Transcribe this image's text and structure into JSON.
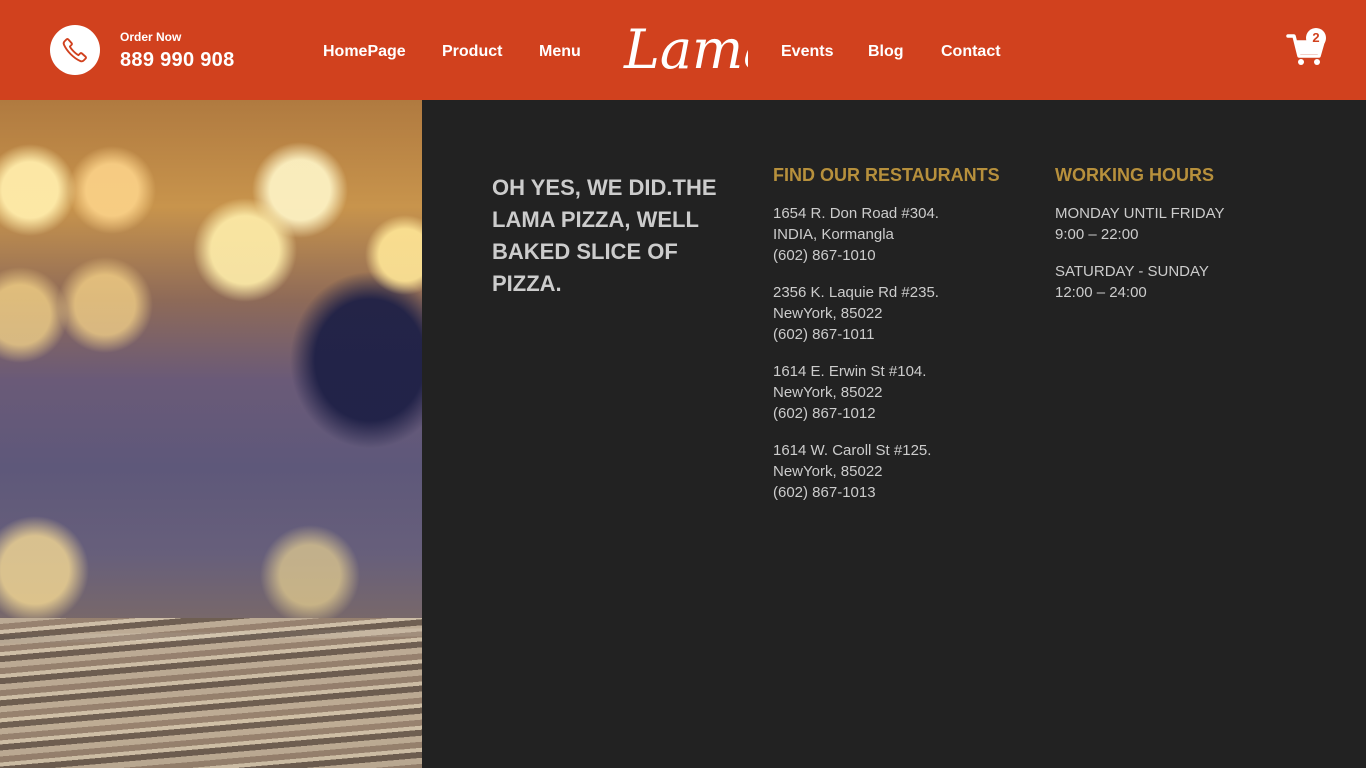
{
  "header": {
    "order_label": "Order Now",
    "order_number": "889 990 908",
    "nav": {
      "homepage": "HomePage",
      "product": "Product",
      "menu": "Menu",
      "events": "Events",
      "blog": "Blog",
      "contact": "Contact"
    },
    "logo_text": "Lama",
    "cart_count": "2",
    "icons": {
      "phone": "phone-icon",
      "cart": "cart-icon"
    }
  },
  "footer": {
    "motto": "OH YES, WE DID.THE LAMA PIZZA, WELL BAKED SLICE OF PIZZA.",
    "restaurants_title": "FIND OUR RESTAURANTS",
    "restaurants": [
      {
        "line1": "1654 R. Don Road #304.",
        "line2": "INDIA, Kormangla",
        "phone": "(602) 867-1010"
      },
      {
        "line1": "2356 K. Laquie Rd #235.",
        "line2": "NewYork, 85022",
        "phone": "(602) 867-1011"
      },
      {
        "line1": "1614 E. Erwin St #104.",
        "line2": "NewYork, 85022",
        "phone": "(602) 867-1012"
      },
      {
        "line1": "1614 W. Caroll St #125.",
        "line2": "NewYork, 85022",
        "phone": "(602) 867-1013"
      }
    ],
    "hours_title": "WORKING HOURS",
    "hours": [
      {
        "days": "MONDAY UNTIL FRIDAY",
        "time": "9:00 – 22:00"
      },
      {
        "days": "SATURDAY - SUNDAY",
        "time": "12:00 – 24:00"
      }
    ]
  },
  "colors": {
    "brand": "#d1411e",
    "background": "#222222",
    "heading_gold": "#b7903c",
    "text": "#cccccc"
  }
}
